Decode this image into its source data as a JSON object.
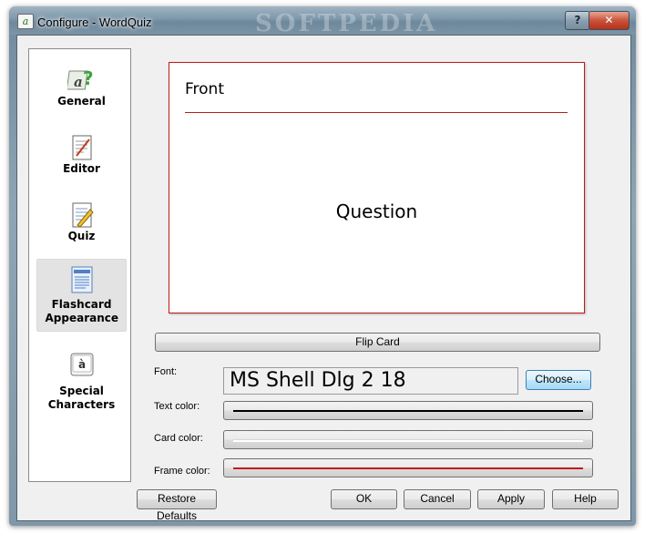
{
  "window": {
    "title": "Configure - WordQuiz",
    "app_icon_glyph": "a",
    "help_glyph": "?",
    "close_glyph": "✕",
    "watermark": "SOFTPEDIA"
  },
  "sidebar": {
    "items": [
      {
        "label": "General",
        "icon": "general-icon"
      },
      {
        "label": "Editor",
        "icon": "editor-icon"
      },
      {
        "label": "Quiz",
        "icon": "quiz-icon"
      },
      {
        "label": "Flashcard Appearance",
        "icon": "flashcard-icon",
        "selected": true
      },
      {
        "label": "Special Characters",
        "icon": "special-characters-icon"
      }
    ]
  },
  "preview": {
    "side_label": "Front",
    "card_text": "Question"
  },
  "buttons": {
    "flip_card": "Flip Card",
    "choose": "Choose...",
    "restore_defaults": "Restore Defaults",
    "ok": "OK",
    "cancel": "Cancel",
    "apply": "Apply",
    "help": "Help"
  },
  "settings": {
    "font_label": "Font:",
    "font_value": "MS Shell Dlg 2 18",
    "text_color_label": "Text color:",
    "card_color_label": "Card color:",
    "frame_color_label": "Frame color:"
  },
  "colors": {
    "text_color": "#000000",
    "card_color": "#ffffff",
    "frame_color": "#c11b1b"
  }
}
